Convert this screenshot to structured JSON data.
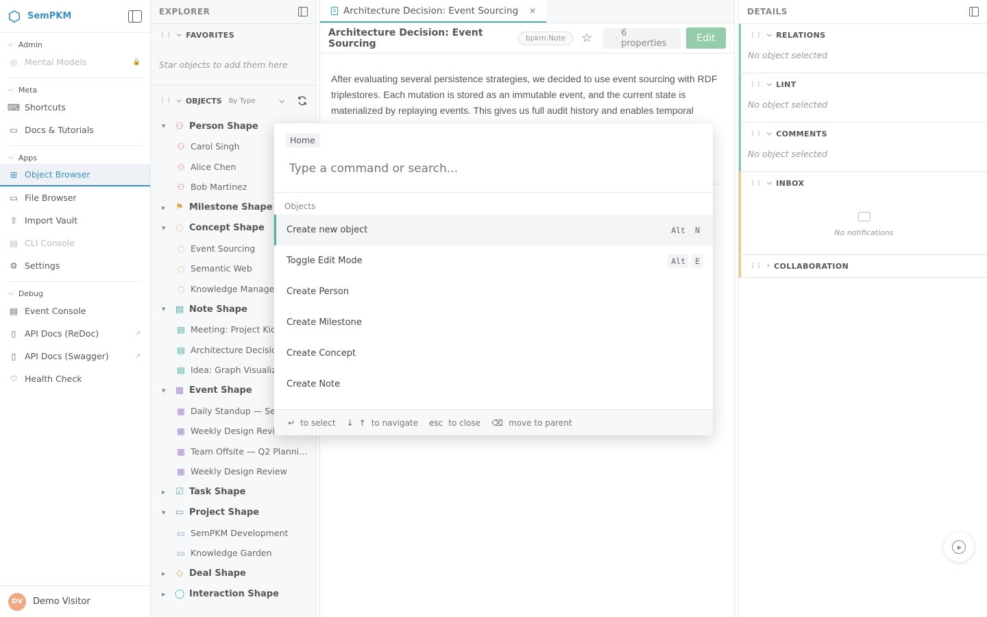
{
  "app": {
    "name": "SemPKM"
  },
  "sidebar": {
    "sections": [
      {
        "heading": "Admin",
        "items": [
          {
            "label": "Mental Models",
            "icon": "brain-icon",
            "state": "disabled",
            "locked": true
          }
        ]
      },
      {
        "heading": "Meta",
        "items": [
          {
            "label": "Shortcuts",
            "icon": "keyboard-icon"
          },
          {
            "label": "Docs & Tutorials",
            "icon": "book-icon"
          }
        ]
      },
      {
        "heading": "Apps",
        "items": [
          {
            "label": "Object Browser",
            "icon": "tree-icon",
            "state": "active"
          },
          {
            "label": "File Browser",
            "icon": "folder-icon"
          },
          {
            "label": "Import Vault",
            "icon": "upload-icon"
          },
          {
            "label": "CLI Console",
            "icon": "terminal-icon",
            "state": "disabled"
          },
          {
            "label": "Settings",
            "icon": "gear-icon"
          }
        ]
      },
      {
        "heading": "Debug",
        "items": [
          {
            "label": "Event Console",
            "icon": "console-icon"
          },
          {
            "label": "API Docs (ReDoc)",
            "icon": "doc-icon",
            "external": true
          },
          {
            "label": "API Docs (Swagger)",
            "icon": "doc-icon",
            "external": true
          },
          {
            "label": "Health Check",
            "icon": "heart-pulse-icon"
          }
        ]
      }
    ],
    "user": {
      "initials": "DV",
      "name": "Demo Visitor"
    }
  },
  "explorer": {
    "title": "EXPLORER",
    "favorites": {
      "title": "FAVORITES",
      "empty": "Star objects to add them here"
    },
    "objects": {
      "title": "OBJECTS",
      "group_by": "By Type",
      "types": [
        {
          "label": "Person Shape",
          "expanded": true,
          "icon": "person-icon",
          "color": "#e07a8a",
          "items": [
            "Carol Singh",
            "Alice Chen",
            "Bob Martinez"
          ]
        },
        {
          "label": "Milestone Shape",
          "expanded": false,
          "icon": "flag-icon",
          "color": "#e0a64a",
          "items": []
        },
        {
          "label": "Concept Shape",
          "expanded": true,
          "icon": "lightbulb-icon",
          "color": "#e0a64a",
          "items": [
            "Event Sourcing",
            "Semantic Web",
            "Knowledge Manager"
          ]
        },
        {
          "label": "Note Shape",
          "expanded": true,
          "icon": "note-icon",
          "color": "#4bb1a3",
          "items": [
            "Meeting: Project Kic",
            "Architecture Decisio",
            "Idea: Graph Visualiz"
          ]
        },
        {
          "label": "Event Shape",
          "expanded": true,
          "icon": "calendar-icon",
          "color": "#a88bd0",
          "items": [
            "Daily Standup — Ser",
            "Weekly Design Review (O…",
            "Team Offsite — Q2 Planni…",
            "Weekly Design Review"
          ]
        },
        {
          "label": "Task Shape",
          "expanded": false,
          "icon": "checkbox-icon",
          "color": "#4bb1a3",
          "items": []
        },
        {
          "label": "Project Shape",
          "expanded": true,
          "icon": "project-folder-icon",
          "color": "#7a8fd0",
          "items": [
            "SemPKM Development",
            "Knowledge Garden"
          ]
        },
        {
          "label": "Deal Shape",
          "expanded": false,
          "icon": "handshake-icon",
          "color": "#e0a64a",
          "items": []
        },
        {
          "label": "Interaction Shape",
          "expanded": false,
          "icon": "chat-bubble-icon",
          "color": "#4bb1a3",
          "items": []
        }
      ]
    }
  },
  "editor": {
    "tab_title": "Architecture Decision: Event Sourcing",
    "object_title": "Architecture Decision: Event Sourcing",
    "type_badge": "bpkm:Note",
    "properties_label": "6 properties",
    "edit_label": "Edit",
    "body": "After evaluating several persistence strategies, we decided to use event sourcing with RDF triplestores. Each mutation is stored as an immutable event, and the current state is materialized by replaying events. This gives us full audit history and enables temporal"
  },
  "details": {
    "title": "DETAILS",
    "sections": [
      {
        "title": "RELATIONS",
        "empty": "No object selected"
      },
      {
        "title": "LINT",
        "empty": "No object selected"
      },
      {
        "title": "COMMENTS",
        "empty": "No object selected"
      }
    ],
    "inbox": {
      "title": "INBOX",
      "empty": "No notifications"
    },
    "collaboration": {
      "title": "COLLABORATION"
    }
  },
  "palette": {
    "breadcrumb": "Home",
    "placeholder": "Type a command or search...",
    "group": "Objects",
    "items": [
      {
        "label": "Create new object",
        "keys": [
          "Alt",
          "N"
        ],
        "selected": true
      },
      {
        "label": "Toggle Edit Mode",
        "keys": [
          "Alt",
          "E"
        ]
      },
      {
        "label": "Create Person",
        "keys": []
      },
      {
        "label": "Create Milestone",
        "keys": []
      },
      {
        "label": "Create Concept",
        "keys": []
      },
      {
        "label": "Create Note",
        "keys": []
      }
    ],
    "footer": {
      "select": "to select",
      "navigate": "to navigate",
      "esc_key": "esc",
      "close": "to close",
      "parent": "move to parent"
    }
  }
}
